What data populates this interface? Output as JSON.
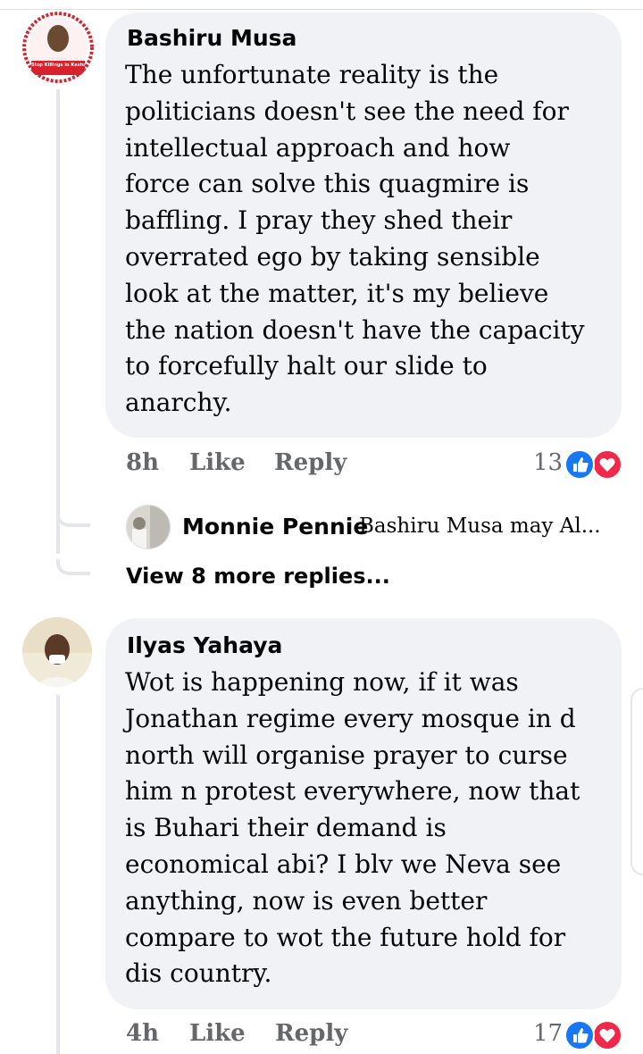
{
  "comments": [
    {
      "author": "Bashiru Musa",
      "avatar_caption": "Stop Killings in Kashmir",
      "lines": [
        "The unfortunate reality is the",
        "politicians doesn't see the need for",
        "intellectual approach and how",
        "force can solve this quagmire is",
        "baffling. I pray they shed their",
        "overrated ego by taking sensible",
        "look at the matter, it's my believe",
        "the nation doesn't have the capacity",
        "to forcefully halt our slide to",
        "anarchy."
      ],
      "time": "8h",
      "like_label": "Like",
      "reply_label": "Reply",
      "reaction_count": "13",
      "reactions": [
        "like-icon",
        "love-icon"
      ],
      "reply_preview": {
        "name": "Monnie Pennie",
        "snippet": "Bashiru Musa may Al..."
      },
      "view_more_label": "View 8 more replies..."
    },
    {
      "author": "Ilyas Yahaya",
      "lines": [
        "Wot is happening now, if it was",
        "Jonathan regime every mosque in d",
        "north will organise prayer to curse",
        "him n protest everywhere, now that",
        "is Buhari their demand is",
        "economical abi? I blv we Neva see",
        "anything, now is even better",
        "compare to wot the future hold for",
        "dis country."
      ],
      "time": "4h",
      "like_label": "Like",
      "reply_label": "Reply",
      "reaction_count": "17",
      "reactions": [
        "like-icon",
        "love-icon"
      ]
    }
  ],
  "colors": {
    "bubble_bg": "#f0f2f5",
    "meta_text": "#65676b",
    "like_blue": "#1877f2",
    "love_red": "#f02849",
    "thread_line": "#e4e6eb"
  }
}
